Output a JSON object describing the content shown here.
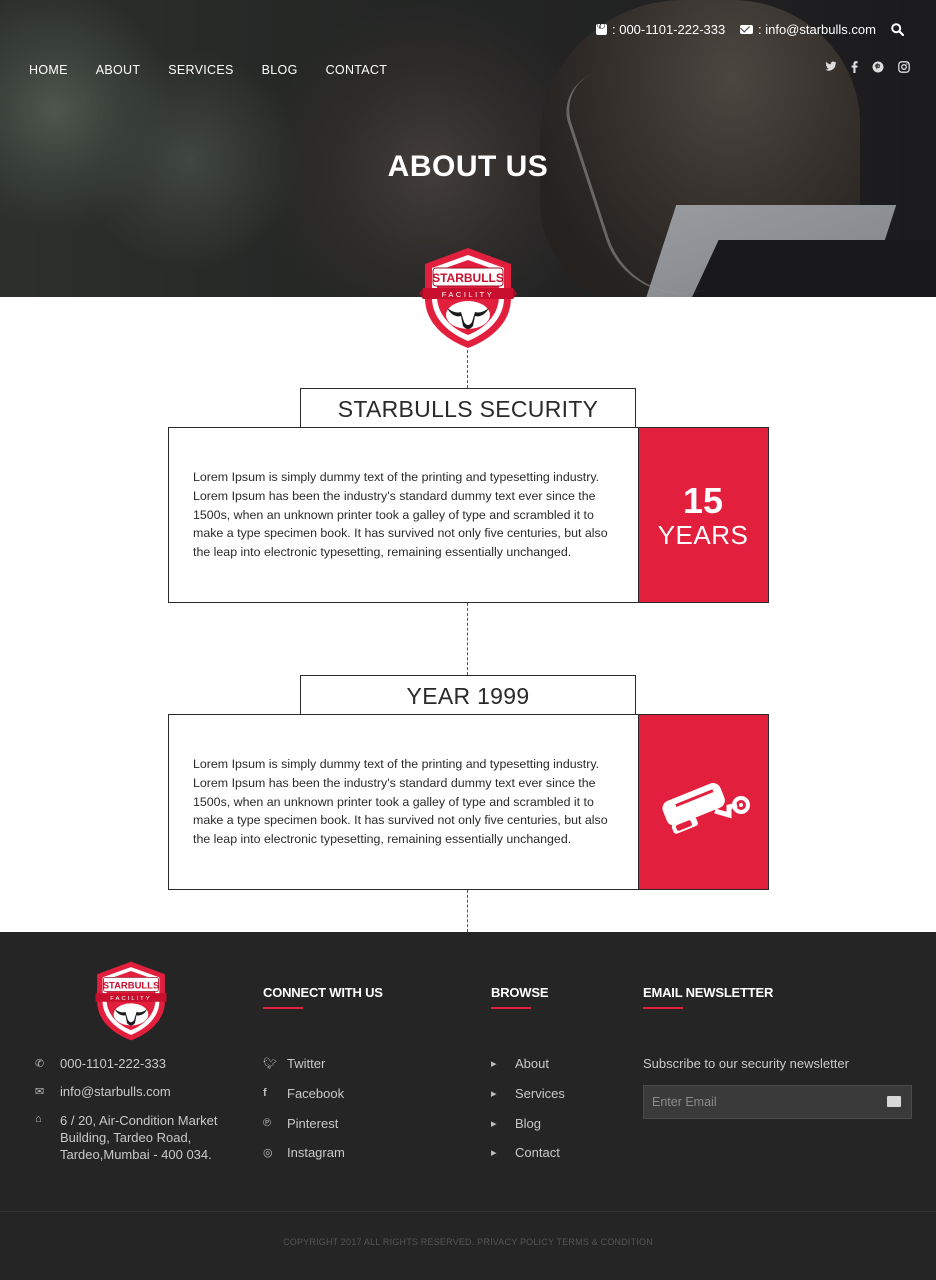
{
  "topbar": {
    "phone": ": 000-1101-222-333",
    "email": ": info@starbulls.com"
  },
  "nav": [
    "HOME",
    "ABOUT",
    "SERVICES",
    "BLOG",
    "CONTACT"
  ],
  "social_icons": [
    "twitter-icon",
    "facebook-icon",
    "pinterest-icon",
    "instagram-icon"
  ],
  "hero": {
    "title": "ABOUT US"
  },
  "badge": {
    "line1": "STARBULLS",
    "line2": "FACILITY"
  },
  "timeline": [
    {
      "title": "STARBULLS SECURITY",
      "text": "Lorem Ipsum is simply dummy text of the printing and typesetting industry. Lorem Ipsum has been the industry's standard dummy text ever since the 1500s, when an unknown printer took a galley of type and scrambled it to make a type specimen book. It has survived not only five centuries, but also the leap into electronic typesetting, remaining essentially unchanged.",
      "number": "15",
      "unit": "YEARS"
    },
    {
      "title": "YEAR 1999",
      "text": "Lorem Ipsum is simply dummy text of the printing and typesetting industry. Lorem Ipsum has been the industry's standard dummy text ever since the 1500s, when an unknown printer took a galley of type and scrambled it to make a type specimen book. It has survived not only five centuries, but also the leap into electronic typesetting, remaining essentially unchanged.",
      "icon": "cctv-camera-icon"
    }
  ],
  "footer": {
    "contact": {
      "phone": "000-1101-222-333",
      "email": "info@starbulls.com",
      "address_lines": [
        "6 / 20, Air-Condition Market",
        "Building, Tardeo Road,",
        "Tardeo,Mumbai - 400 034."
      ]
    },
    "connect": {
      "title": "CONNECT WITH US",
      "items": [
        "Twitter",
        "Facebook",
        "Pinterest",
        "Instagram"
      ]
    },
    "browse": {
      "title": "BROWSE",
      "items": [
        "About",
        "Services",
        "Blog",
        "Contact"
      ]
    },
    "newsletter": {
      "title": "EMAIL NEWSLETTER",
      "text": "Subscribe to our security newsletter",
      "placeholder": "Enter Email"
    },
    "copyright": "COPYRIGHT 2017 ALL RIGHTS RESERVED. PRIVACY POLICY TERMS & CONDITION"
  },
  "colors": {
    "accent": "#e21f3c",
    "footer_bg": "#252525",
    "border": "#2a2a2a"
  }
}
